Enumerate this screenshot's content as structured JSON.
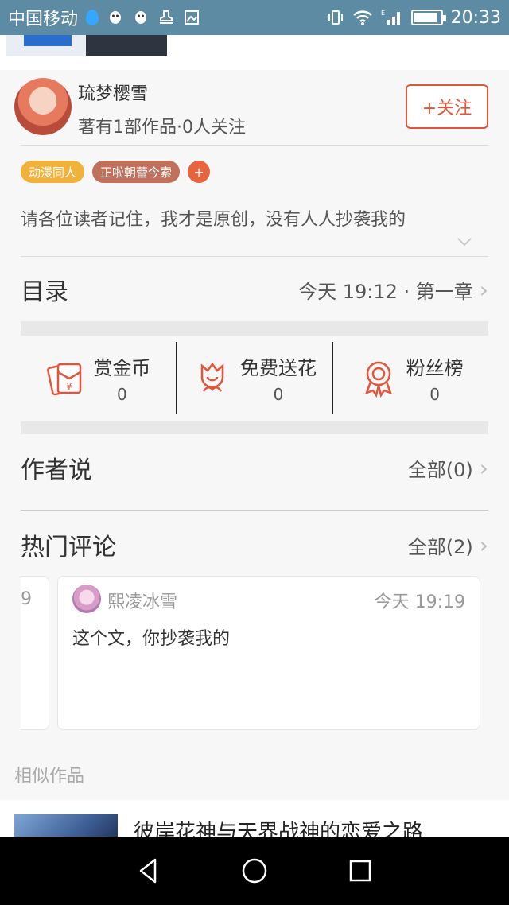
{
  "status_bar": {
    "carrier": "中国移动",
    "time": "20:33"
  },
  "author": {
    "name": "琉梦樱雪",
    "stats": "著有1部作品·0人关注",
    "follow_label": "+关注"
  },
  "tags": [
    "动漫同人",
    "正啦朝蕾今索"
  ],
  "tag_add_label": "+",
  "description": "请各位读者记住，我才是原创，没有人人抄袭我的",
  "catalog": {
    "title": "目录",
    "update": "今天 19:12 · 第一章"
  },
  "rewards": [
    {
      "label": "赏金币",
      "count": "0",
      "icon": "red-envelope-icon"
    },
    {
      "label": "免费送花",
      "count": "0",
      "icon": "flower-icon"
    },
    {
      "label": "粉丝榜",
      "count": "0",
      "icon": "medal-icon"
    }
  ],
  "author_says": {
    "title": "作者说",
    "all": "全部(0)"
  },
  "hot_comments": {
    "title": "热门评论",
    "all": "全部(2)"
  },
  "comments": [
    {
      "partial_text": "9"
    },
    {
      "user": "熙凌冰雪",
      "time": "今天 19:19",
      "text": "这个文，你抄袭我的"
    }
  ],
  "similar": {
    "title": "相似作品",
    "first_book": "彼岸花神与天界战神的恋爱之路"
  },
  "colors": {
    "accent": "#e2553a",
    "statusbar": "#5d8ba3",
    "tag1": "#f0b23b",
    "tag2": "#c1715b"
  }
}
